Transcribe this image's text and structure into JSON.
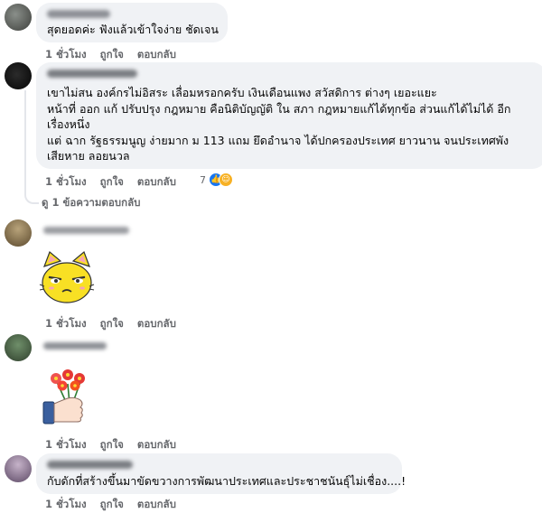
{
  "comments": [
    {
      "text_lines": [
        "สุดยอดค่ะ ฟังแล้วเข้าใจง่าย ชัดเจน"
      ],
      "time": "1 ชั่วโมง",
      "like": "ถูกใจ",
      "reply": "ตอบกลับ"
    },
    {
      "text_lines": [
        "เขาไม่สน องค์กรไม่อิสระ เลื่อมหรอกครับ เงินเดือนแพง สวัสดิการ ต่างๆ เยอะแยะ",
        "หน้าที่ ออก แก้ ปรับปรุง กฎหมาย คือนิติบัญญัติ ใน สภา กฎหมายแก้ได้ทุกข้อ ส่วนแก้ได้ไม่ได้ อีก",
        "เรื่องหนึ่ง",
        "แต่ ฉาก รัฐธรรมนูญ ง่ายมาก ม 113 แถม ยึดอำนาจ ได้ปกครองประเทศ ยาวนาน จนประเทศพัง",
        "เสียหาย ลอยนวล"
      ],
      "time": "1 ชั่วโมง",
      "like": "ถูกใจ",
      "reply": "ตอบกลับ",
      "reaction_count": "7",
      "view_replies": "ดู 1 ข้อความตอบกลับ"
    },
    {
      "sticker": "cat-sticker",
      "time": "1 ชั่วโมง",
      "like": "ถูกใจ",
      "reply": "ตอบกลับ"
    },
    {
      "sticker": "flower-thumbs-up-sticker",
      "time": "1 ชั่วโมง",
      "like": "ถูกใจ",
      "reply": "ตอบกลับ"
    },
    {
      "text_lines": [
        "กับดักที่สร้างขึ้นมาขัดขวางการพัฒนาประเทศและประชาชนันธุ์ไม่เชื่อง....!"
      ],
      "time": "1 ชั่วโมง",
      "like": "ถูกใจ",
      "reply": "ตอบกลับ"
    }
  ],
  "colors": {
    "bubble": "#f0f2f5",
    "meta_text": "#65676b",
    "like_blue": "#1877f2",
    "haha_yellow": "#f7b125"
  }
}
